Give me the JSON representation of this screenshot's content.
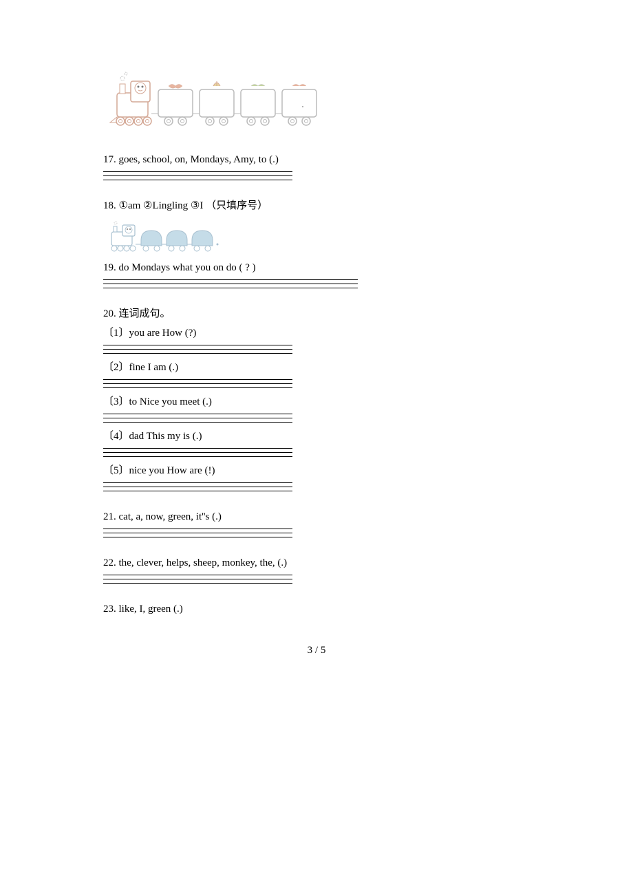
{
  "questions": {
    "q17": {
      "text": "17. goes, school, on, Mondays, Amy, to (.)"
    },
    "q18": {
      "prefix": "18. ",
      "opt1_num": "①",
      "opt1_word": "am ",
      "opt2_num": "②",
      "opt2_word": "Lingling   ",
      "opt3_num": "③",
      "opt3_word": "I  ",
      "suffix": "（只填序号）"
    },
    "q19": {
      "text": "19. do  Mondays  what you  on  do ( ? )"
    },
    "q20": {
      "header": "20. 连词成句。",
      "sub1": "〔1〕you are How (?)",
      "sub2": "〔2〕fine  I  am  (.)",
      "sub3": "〔3〕to Nice you meet (.)",
      "sub4": "〔4〕dad This my is (.)",
      "sub5": "〔5〕nice  you  How  are  (!)"
    },
    "q21": {
      "text": "21. cat, a, now, green, it''s  (.)"
    },
    "q22": {
      "text": "22. the, clever, helps, sheep, monkey, the, (.)"
    },
    "q23": {
      "text": "23. like,  I,  green (.)"
    }
  },
  "page_number": "3 / 5"
}
